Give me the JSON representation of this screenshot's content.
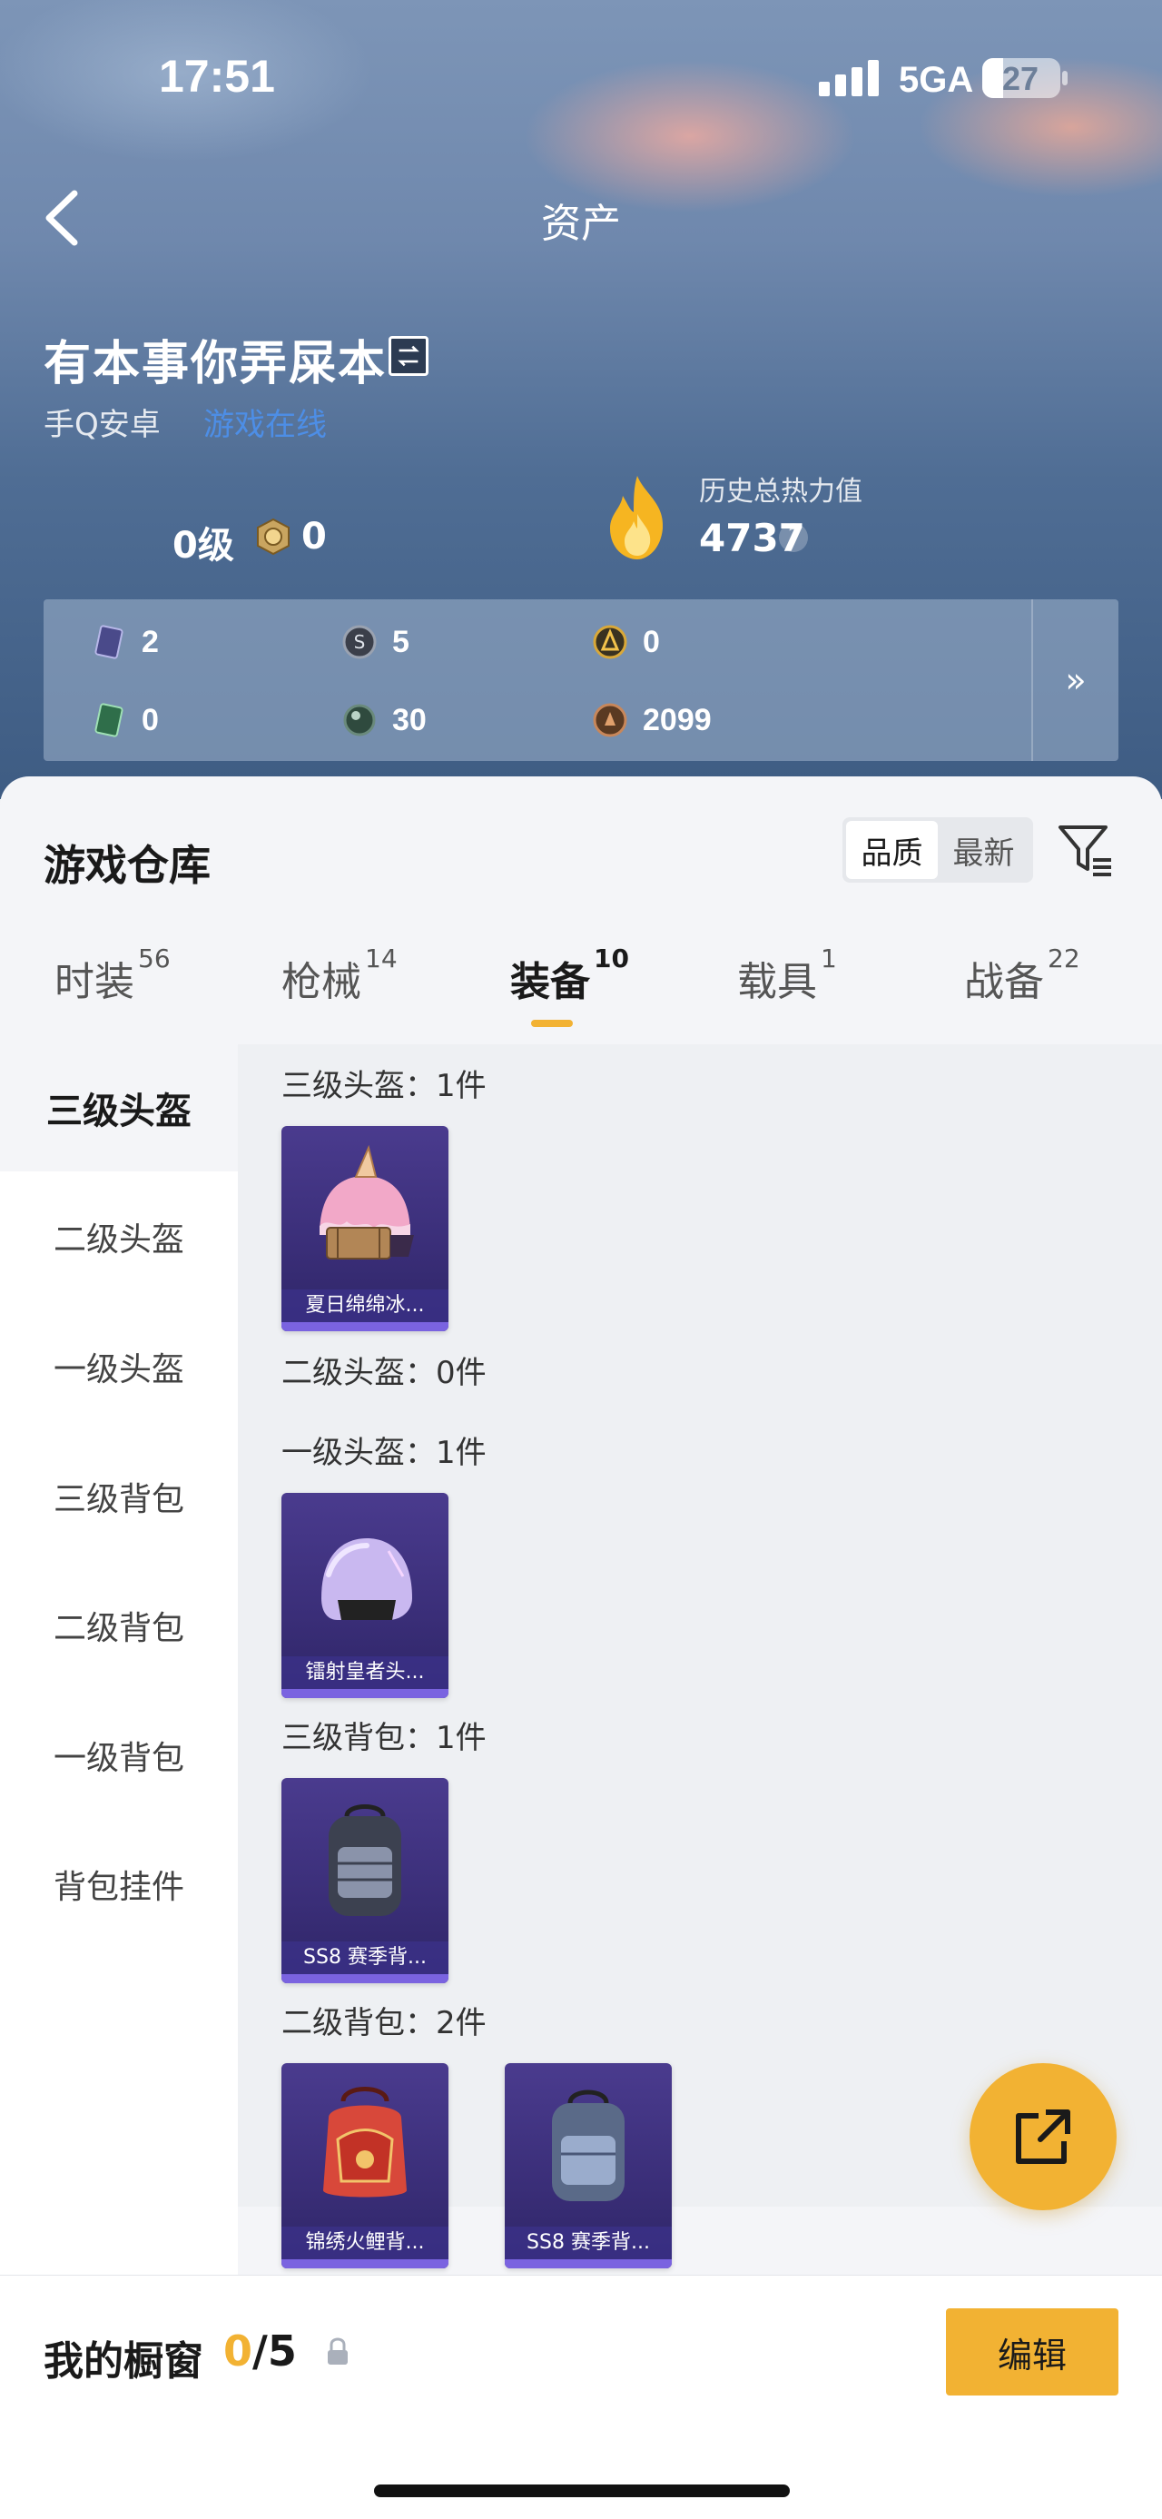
{
  "status_bar": {
    "time": "17:51",
    "network": "5GA",
    "battery": "27",
    "battery_level": 0.27
  },
  "nav": {
    "title": "资产"
  },
  "profile": {
    "name": "有本事你弄屎本",
    "platform": "手Q安卓",
    "status": "游戏在线",
    "level": "0级",
    "badge_value": "0",
    "heat_label": "历史总热力值",
    "heat_value": "4737",
    "help": "?"
  },
  "currencies": [
    {
      "icon": "card-icon",
      "value": "2"
    },
    {
      "icon": "coin-s-icon",
      "value": "5"
    },
    {
      "icon": "gold-coin-icon",
      "value": "0"
    },
    {
      "icon": "green-card-icon",
      "value": "0"
    },
    {
      "icon": "gem-icon",
      "value": "30"
    },
    {
      "icon": "bronze-coin-icon",
      "value": "2099"
    }
  ],
  "more_icon": "»",
  "warehouse": {
    "title": "游戏仓库",
    "sort": [
      "品质",
      "最新"
    ],
    "tabs": [
      {
        "label": "时装",
        "count": "56"
      },
      {
        "label": "枪械",
        "count": "14"
      },
      {
        "label": "装备",
        "count": "10"
      },
      {
        "label": "载具",
        "count": "1"
      },
      {
        "label": "战备",
        "count": "22"
      }
    ],
    "sidebar": [
      "三级头盔",
      "二级头盔",
      "一级头盔",
      "三级背包",
      "二级背包",
      "一级背包",
      "背包挂件"
    ],
    "sections": [
      {
        "title": "三级头盔：1件",
        "items": [
          "夏日绵绵冰..."
        ]
      },
      {
        "title": "二级头盔：0件",
        "items": []
      },
      {
        "title": "一级头盔：1件",
        "items": [
          "镭射皇者头..."
        ]
      },
      {
        "title": "三级背包：1件",
        "items": [
          "SS8 赛季背..."
        ]
      },
      {
        "title": "二级背包：2件",
        "items": [
          "锦绣火鲤背...",
          "SS8 赛季背..."
        ]
      }
    ]
  },
  "showcase": {
    "label": "我的橱窗",
    "current": "0",
    "total": "/5",
    "edit": "编辑"
  },
  "colors": {
    "accent": "#f2b233",
    "link": "#4d8ee6",
    "card": "#3a2e78"
  }
}
